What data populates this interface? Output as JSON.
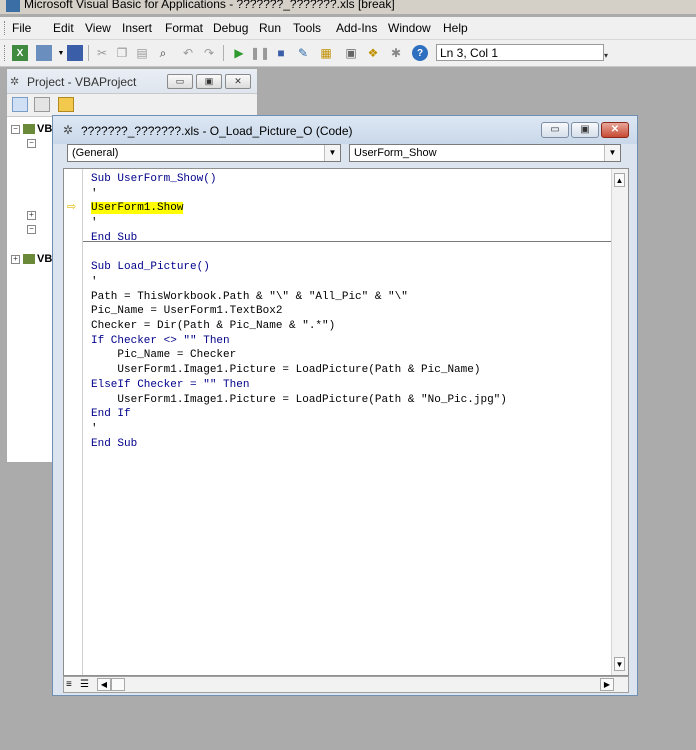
{
  "app": {
    "title": "Microsoft Visual Basic for Applications - ???????_???????.xls [break]"
  },
  "menu": [
    "File",
    "Edit",
    "View",
    "Insert",
    "Format",
    "Debug",
    "Run",
    "Tools",
    "Add-Ins",
    "Window",
    "Help"
  ],
  "toolbar": {
    "position": "Ln 3, Col 1"
  },
  "project": {
    "title": "Project - VBAProject",
    "tree": [
      "VB",
      "VB"
    ]
  },
  "code_window": {
    "title": "???????_???????.xls - O_Load_Picture_O (Code)",
    "object_combo": "(General)",
    "proc_combo": "UserForm_Show",
    "lines": [
      "Sub UserForm_Show()",
      "'",
      "UserForm1.Show",
      "'",
      "End Sub",
      "",
      "Sub Load_Picture()",
      "'",
      "Path = ThisWorkbook.Path & \"\\\" & \"All_Pic\" & \"\\\"",
      "Pic_Name = UserForm1.TextBox2",
      "Checker = Dir(Path & Pic_Name & \".*\")",
      "If Checker <> \"\" Then",
      "    Pic_Name = Checker",
      "    UserForm1.Image1.Picture = LoadPicture(Path & Pic_Name)",
      "ElseIf Checker = \"\" Then",
      "    UserForm1.Image1.Picture = LoadPicture(Path & \"No_Pic.jpg\")",
      "End If",
      "'",
      "End Sub"
    ]
  },
  "colors": {
    "keyword": "#00008b",
    "highlight": "#ffff00",
    "break_pointer": "#e0b800"
  }
}
